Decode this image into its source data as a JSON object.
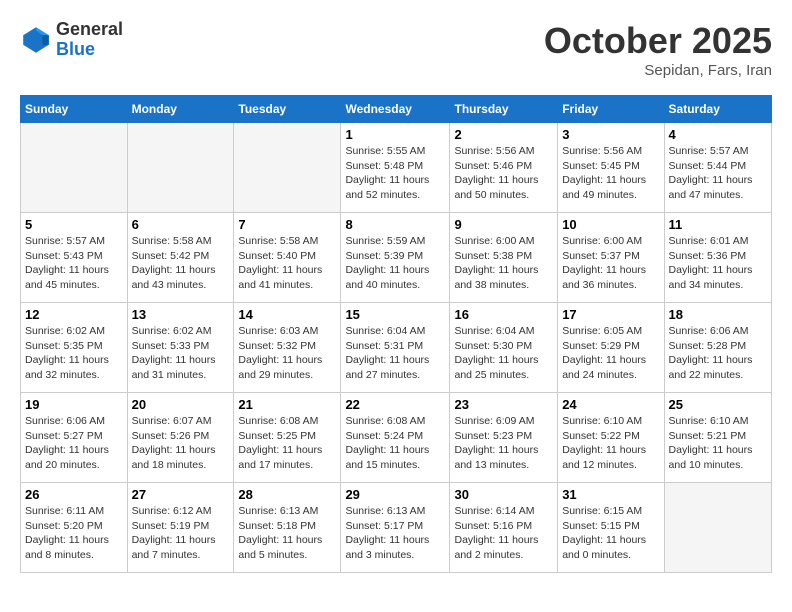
{
  "header": {
    "logo_general": "General",
    "logo_blue": "Blue",
    "month": "October 2025",
    "location": "Sepidan, Fars, Iran"
  },
  "weekdays": [
    "Sunday",
    "Monday",
    "Tuesday",
    "Wednesday",
    "Thursday",
    "Friday",
    "Saturday"
  ],
  "weeks": [
    [
      {
        "day": "",
        "info": ""
      },
      {
        "day": "",
        "info": ""
      },
      {
        "day": "",
        "info": ""
      },
      {
        "day": "1",
        "info": "Sunrise: 5:55 AM\nSunset: 5:48 PM\nDaylight: 11 hours\nand 52 minutes."
      },
      {
        "day": "2",
        "info": "Sunrise: 5:56 AM\nSunset: 5:46 PM\nDaylight: 11 hours\nand 50 minutes."
      },
      {
        "day": "3",
        "info": "Sunrise: 5:56 AM\nSunset: 5:45 PM\nDaylight: 11 hours\nand 49 minutes."
      },
      {
        "day": "4",
        "info": "Sunrise: 5:57 AM\nSunset: 5:44 PM\nDaylight: 11 hours\nand 47 minutes."
      }
    ],
    [
      {
        "day": "5",
        "info": "Sunrise: 5:57 AM\nSunset: 5:43 PM\nDaylight: 11 hours\nand 45 minutes."
      },
      {
        "day": "6",
        "info": "Sunrise: 5:58 AM\nSunset: 5:42 PM\nDaylight: 11 hours\nand 43 minutes."
      },
      {
        "day": "7",
        "info": "Sunrise: 5:58 AM\nSunset: 5:40 PM\nDaylight: 11 hours\nand 41 minutes."
      },
      {
        "day": "8",
        "info": "Sunrise: 5:59 AM\nSunset: 5:39 PM\nDaylight: 11 hours\nand 40 minutes."
      },
      {
        "day": "9",
        "info": "Sunrise: 6:00 AM\nSunset: 5:38 PM\nDaylight: 11 hours\nand 38 minutes."
      },
      {
        "day": "10",
        "info": "Sunrise: 6:00 AM\nSunset: 5:37 PM\nDaylight: 11 hours\nand 36 minutes."
      },
      {
        "day": "11",
        "info": "Sunrise: 6:01 AM\nSunset: 5:36 PM\nDaylight: 11 hours\nand 34 minutes."
      }
    ],
    [
      {
        "day": "12",
        "info": "Sunrise: 6:02 AM\nSunset: 5:35 PM\nDaylight: 11 hours\nand 32 minutes."
      },
      {
        "day": "13",
        "info": "Sunrise: 6:02 AM\nSunset: 5:33 PM\nDaylight: 11 hours\nand 31 minutes."
      },
      {
        "day": "14",
        "info": "Sunrise: 6:03 AM\nSunset: 5:32 PM\nDaylight: 11 hours\nand 29 minutes."
      },
      {
        "day": "15",
        "info": "Sunrise: 6:04 AM\nSunset: 5:31 PM\nDaylight: 11 hours\nand 27 minutes."
      },
      {
        "day": "16",
        "info": "Sunrise: 6:04 AM\nSunset: 5:30 PM\nDaylight: 11 hours\nand 25 minutes."
      },
      {
        "day": "17",
        "info": "Sunrise: 6:05 AM\nSunset: 5:29 PM\nDaylight: 11 hours\nand 24 minutes."
      },
      {
        "day": "18",
        "info": "Sunrise: 6:06 AM\nSunset: 5:28 PM\nDaylight: 11 hours\nand 22 minutes."
      }
    ],
    [
      {
        "day": "19",
        "info": "Sunrise: 6:06 AM\nSunset: 5:27 PM\nDaylight: 11 hours\nand 20 minutes."
      },
      {
        "day": "20",
        "info": "Sunrise: 6:07 AM\nSunset: 5:26 PM\nDaylight: 11 hours\nand 18 minutes."
      },
      {
        "day": "21",
        "info": "Sunrise: 6:08 AM\nSunset: 5:25 PM\nDaylight: 11 hours\nand 17 minutes."
      },
      {
        "day": "22",
        "info": "Sunrise: 6:08 AM\nSunset: 5:24 PM\nDaylight: 11 hours\nand 15 minutes."
      },
      {
        "day": "23",
        "info": "Sunrise: 6:09 AM\nSunset: 5:23 PM\nDaylight: 11 hours\nand 13 minutes."
      },
      {
        "day": "24",
        "info": "Sunrise: 6:10 AM\nSunset: 5:22 PM\nDaylight: 11 hours\nand 12 minutes."
      },
      {
        "day": "25",
        "info": "Sunrise: 6:10 AM\nSunset: 5:21 PM\nDaylight: 11 hours\nand 10 minutes."
      }
    ],
    [
      {
        "day": "26",
        "info": "Sunrise: 6:11 AM\nSunset: 5:20 PM\nDaylight: 11 hours\nand 8 minutes."
      },
      {
        "day": "27",
        "info": "Sunrise: 6:12 AM\nSunset: 5:19 PM\nDaylight: 11 hours\nand 7 minutes."
      },
      {
        "day": "28",
        "info": "Sunrise: 6:13 AM\nSunset: 5:18 PM\nDaylight: 11 hours\nand 5 minutes."
      },
      {
        "day": "29",
        "info": "Sunrise: 6:13 AM\nSunset: 5:17 PM\nDaylight: 11 hours\nand 3 minutes."
      },
      {
        "day": "30",
        "info": "Sunrise: 6:14 AM\nSunset: 5:16 PM\nDaylight: 11 hours\nand 2 minutes."
      },
      {
        "day": "31",
        "info": "Sunrise: 6:15 AM\nSunset: 5:15 PM\nDaylight: 11 hours\nand 0 minutes."
      },
      {
        "day": "",
        "info": ""
      }
    ]
  ]
}
